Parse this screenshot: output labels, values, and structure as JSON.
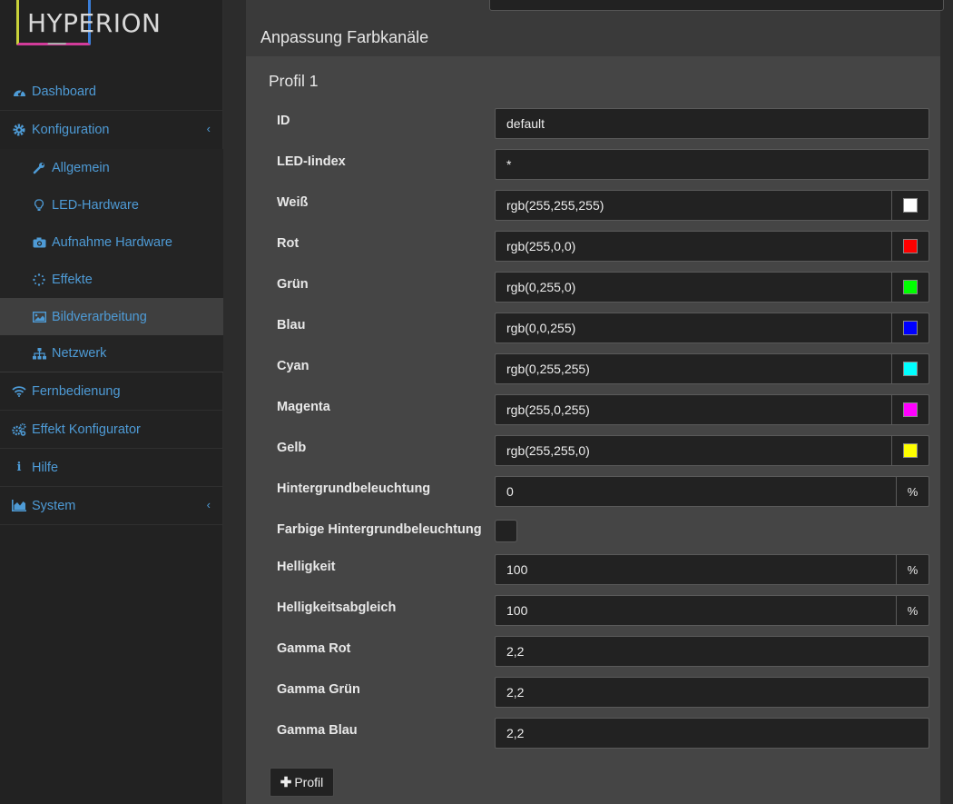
{
  "app": {
    "logo_text": "HYPERION"
  },
  "sidebar": {
    "items": [
      {
        "label": "Dashboard",
        "icon": "dashboard-icon"
      },
      {
        "label": "Konfiguration",
        "icon": "gear-icon"
      },
      {
        "label": "Fernbedienung",
        "icon": "wifi-icon"
      },
      {
        "label": "Effekt Konfigurator",
        "icon": "gears-icon"
      },
      {
        "label": "Hilfe",
        "icon": "info-icon"
      },
      {
        "label": "System",
        "icon": "chart-icon"
      }
    ],
    "sub_items": [
      {
        "label": "Allgemein",
        "icon": "wrench-icon"
      },
      {
        "label": "LED-Hardware",
        "icon": "lightbulb-icon"
      },
      {
        "label": "Aufnahme Hardware",
        "icon": "camera-icon"
      },
      {
        "label": "Effekte",
        "icon": "spinner-icon"
      },
      {
        "label": "Bildverarbeitung",
        "icon": "image-icon",
        "active": true
      },
      {
        "label": "Netzwerk",
        "icon": "sitemap-icon"
      }
    ]
  },
  "main": {
    "section_title": "Anpassung Farbkanäle",
    "profile_title": "Profil 1",
    "fields": {
      "id": {
        "label": "ID",
        "value": "default"
      },
      "led_index": {
        "label": "LED-Iindex",
        "value": "*"
      },
      "white": {
        "label": "Weiß",
        "value": "rgb(255,255,255)",
        "swatch": "#ffffff"
      },
      "red": {
        "label": "Rot",
        "value": "rgb(255,0,0)",
        "swatch": "#ff0000"
      },
      "green": {
        "label": "Grün",
        "value": "rgb(0,255,0)",
        "swatch": "#00ff00"
      },
      "blue": {
        "label": "Blau",
        "value": "rgb(0,0,255)",
        "swatch": "#0000ff"
      },
      "cyan": {
        "label": "Cyan",
        "value": "rgb(0,255,255)",
        "swatch": "#00ffff"
      },
      "magenta": {
        "label": "Magenta",
        "value": "rgb(255,0,255)",
        "swatch": "#ff00ff"
      },
      "yellow": {
        "label": "Gelb",
        "value": "rgb(255,255,0)",
        "swatch": "#ffff00"
      },
      "backlight": {
        "label": "Hintergrundbeleuchtung",
        "value": "0",
        "unit": "%"
      },
      "colored_backlight": {
        "label": "Farbige Hintergrundbeleuchtung",
        "checked": false
      },
      "brightness": {
        "label": "Helligkeit",
        "value": "100",
        "unit": "%"
      },
      "brightness_comp": {
        "label": "Helligkeitsabgleich",
        "value": "100",
        "unit": "%"
      },
      "gamma_red": {
        "label": "Gamma Rot",
        "value": "2,2"
      },
      "gamma_green": {
        "label": "Gamma Grün",
        "value": "2,2"
      },
      "gamma_blue": {
        "label": "Gamma Blau",
        "value": "2,2"
      }
    },
    "add_profile_label": "Profil"
  },
  "colors": {
    "accent": "#4e9bd6",
    "sidebar_bg": "#222222",
    "panel_bg": "#454545"
  }
}
